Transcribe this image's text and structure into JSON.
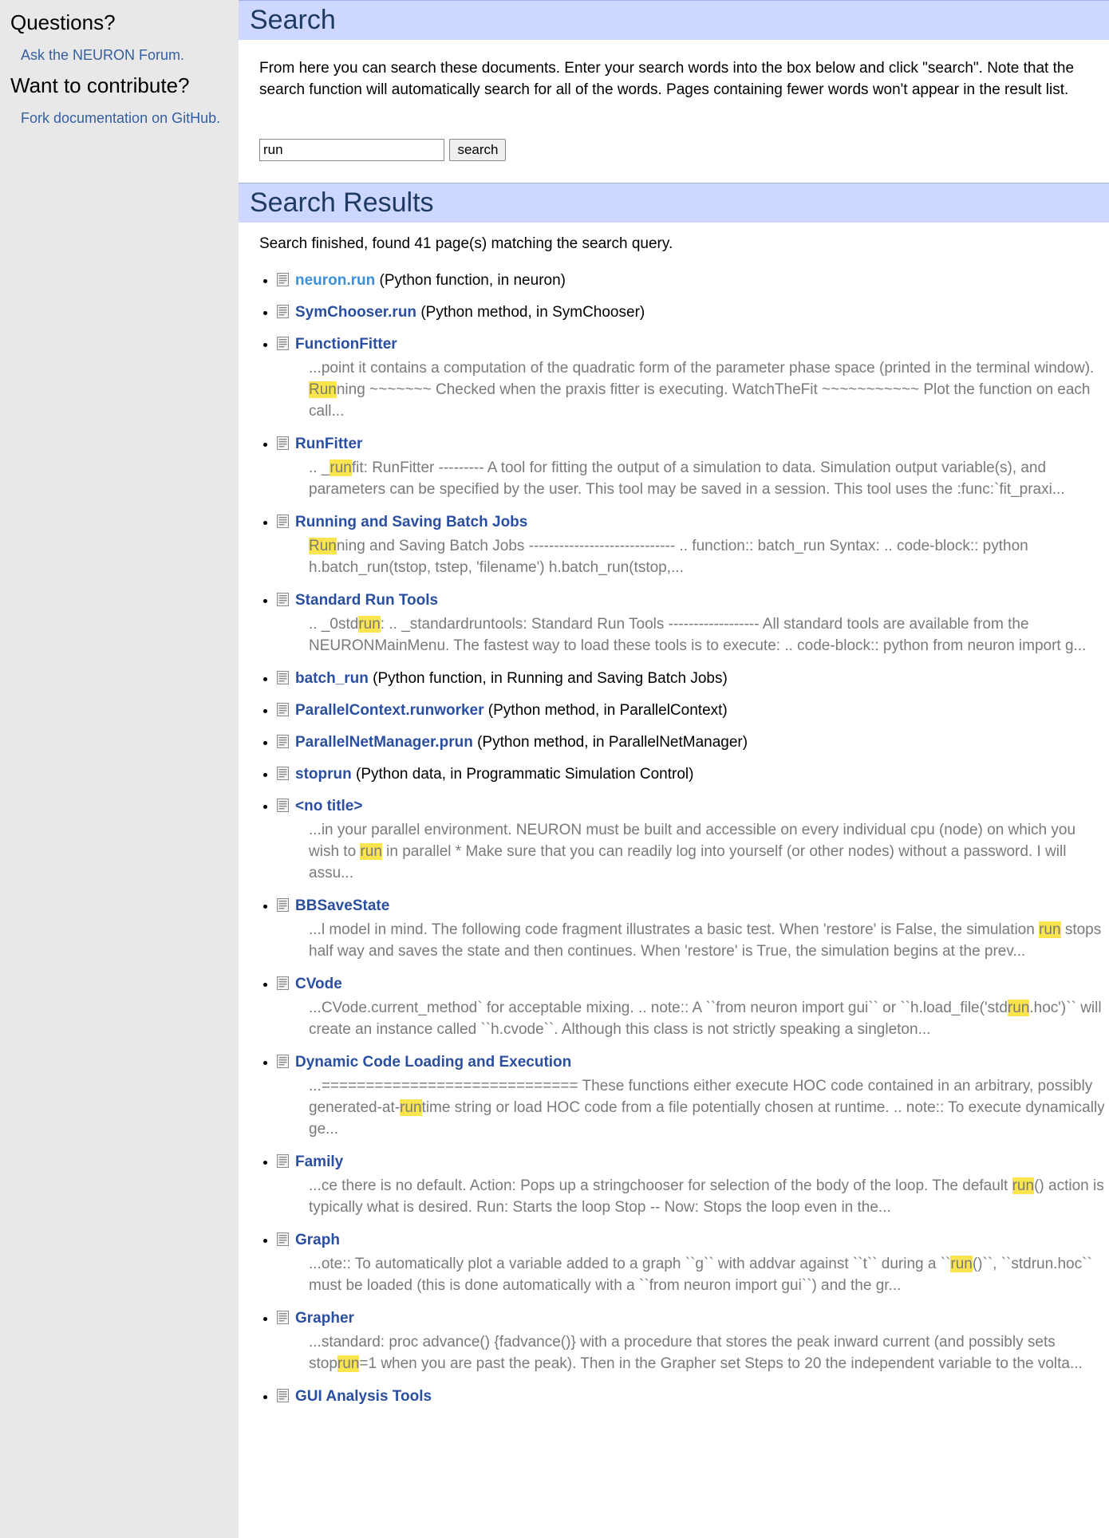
{
  "sidebar": {
    "questions_title": "Questions?",
    "forum_link": "Ask the NEURON Forum.",
    "contribute_title": "Want to contribute?",
    "fork_link": "Fork documentation on GitHub."
  },
  "search": {
    "title": "Search",
    "intro": "From here you can search these documents. Enter your search words into the box below and click \"search\". Note that the search function will automatically search for all of the words. Pages containing fewer words won't appear in the result list.",
    "query": "run",
    "button_label": "search"
  },
  "results_section": {
    "title": "Search Results",
    "status": "Search finished, found 41 page(s) matching the search query."
  },
  "results": [
    {
      "title": "neuron.run",
      "meta": " (Python function, in neuron)",
      "visited": true,
      "ctx": []
    },
    {
      "title": "SymChooser.run",
      "meta": " (Python method, in SymChooser)",
      "ctx": []
    },
    {
      "title": "FunctionFitter",
      "meta": "",
      "ctx": [
        "...point it contains a computation of the quadratic form of the parameter phase space (printed in the terminal window). ",
        "Run",
        "ning ~~~~~~~ Checked when the praxis fitter is executing. WatchTheFit ~~~~~~~~~~~ Plot the function on each call..."
      ]
    },
    {
      "title": "RunFitter",
      "meta": "",
      "ctx": [
        ".. _",
        "run",
        "fit: RunFitter --------- A tool for fitting the output of a simulation to data. Simulation output variable(s), and parameters can be specified by the user. This tool may be saved in a session. This tool uses the :func:`fit_praxi..."
      ]
    },
    {
      "title": "Running and Saving Batch Jobs",
      "meta": "",
      "ctx": [
        "",
        "Run",
        "ning and Saving Batch Jobs ----------------------------- .. function:: batch_run Syntax: .. code-block:: python h.batch_run(tstop, tstep, 'filename') h.batch_run(tstop,..."
      ]
    },
    {
      "title": "Standard Run Tools",
      "meta": "",
      "ctx": [
        ".. _0std",
        "run",
        ": .. _standardruntools: Standard Run Tools ------------------ All standard tools are available from the NEURONMainMenu. The fastest way to load these tools is to execute: .. code-block:: python from neuron import g..."
      ]
    },
    {
      "title": "batch_run",
      "meta": " (Python function, in Running and Saving Batch Jobs)",
      "ctx": []
    },
    {
      "title": "ParallelContext.runworker",
      "meta": " (Python method, in ParallelContext)",
      "ctx": []
    },
    {
      "title": "ParallelNetManager.prun",
      "meta": " (Python method, in ParallelNetManager)",
      "ctx": []
    },
    {
      "title": "stoprun",
      "meta": " (Python data, in Programmatic Simulation Control)",
      "ctx": []
    },
    {
      "title": "<no title>",
      "meta": "",
      "ctx": [
        "...in your parallel environment. NEURON must be built and accessible on every individual cpu (node) on which you wish to ",
        "run",
        " in parallel * Make sure that you can readily log into yourself (or other nodes) without a password. I will assu..."
      ]
    },
    {
      "title": "BBSaveState",
      "meta": "",
      "ctx": [
        "...l model in mind. The following code fragment illustrates a basic test. When 'restore' is False, the simulation ",
        "run",
        " stops half way and saves the state and then continues. When 'restore' is True, the simulation begins at the prev..."
      ]
    },
    {
      "title": "CVode",
      "meta": "",
      "ctx": [
        "...CVode.current_method` for acceptable mixing. .. note:: A ``from neuron import gui`` or ``h.load_file('std",
        "run",
        ".hoc')`` will create an instance called ``h.cvode``. Although this class is not strictly speaking a singleton..."
      ]
    },
    {
      "title": "Dynamic Code Loading and Execution",
      "meta": "",
      "ctx": [
        "...============================= These functions either execute HOC code contained in an arbitrary, possibly generated-at-",
        "run",
        "time string or load HOC code from a file potentially chosen at runtime. .. note:: To execute dynamically ge..."
      ]
    },
    {
      "title": "Family",
      "meta": "",
      "ctx": [
        "...ce there is no default. Action: Pops up a stringchooser for selection of the body of the loop. The default ",
        "run",
        "() action is typically what is desired. Run: Starts the loop Stop -- Now: Stops the loop even in the..."
      ]
    },
    {
      "title": "Graph",
      "meta": "",
      "ctx": [
        "...ote:: To automatically plot a variable added to a graph ``g`` with addvar against ``t`` during a ``",
        "run",
        "()``, ``stdrun.hoc`` must be loaded (this is done automatically with a ``from neuron import gui``) and the gr..."
      ]
    },
    {
      "title": "Grapher",
      "meta": "",
      "ctx": [
        "...standard: proc advance() {fadvance()} with a procedure that stores the peak inward current (and possibly sets stop",
        "run",
        "=1 when you are past the peak). Then in the Grapher set Steps to 20 the independent variable to the volta..."
      ]
    },
    {
      "title": "GUI Analysis Tools",
      "meta": "",
      "ctx": []
    }
  ]
}
